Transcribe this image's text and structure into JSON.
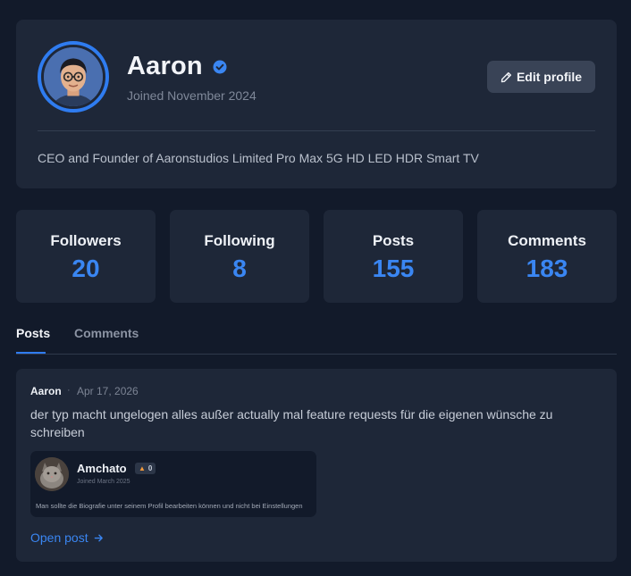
{
  "profile": {
    "name": "Aaron",
    "joined": "Joined November 2024",
    "edit_label": "Edit profile",
    "bio": "CEO and Founder of Aaronstudios Limited Pro Max 5G HD LED HDR Smart TV"
  },
  "stats": [
    {
      "label": "Followers",
      "value": "20"
    },
    {
      "label": "Following",
      "value": "8"
    },
    {
      "label": "Posts",
      "value": "155"
    },
    {
      "label": "Comments",
      "value": "183"
    }
  ],
  "tabs": [
    {
      "label": "Posts",
      "active": true
    },
    {
      "label": "Comments",
      "active": false
    }
  ],
  "post": {
    "author": "Aaron",
    "separator": "·",
    "date": "Apr 17, 2026",
    "text": "der typ macht ungelogen alles außer actually mal feature requests für die eigenen wünsche zu schreiben",
    "embed": {
      "name": "Amchato",
      "badge_count": "0",
      "joined": "Joined March 2025",
      "bio": "Man sollte die Biografie unter seinem Profil bearbeiten können und nicht bei Einstellungen"
    },
    "open_label": "Open post"
  },
  "colors": {
    "background": "#121a2a",
    "card": "#1e2738",
    "accent": "#3a86f2",
    "button": "#394356"
  },
  "icons": {
    "verified": "verified-check-icon",
    "edit": "pencil-icon",
    "arrow": "arrow-right-icon",
    "badge": "flame-icon"
  }
}
